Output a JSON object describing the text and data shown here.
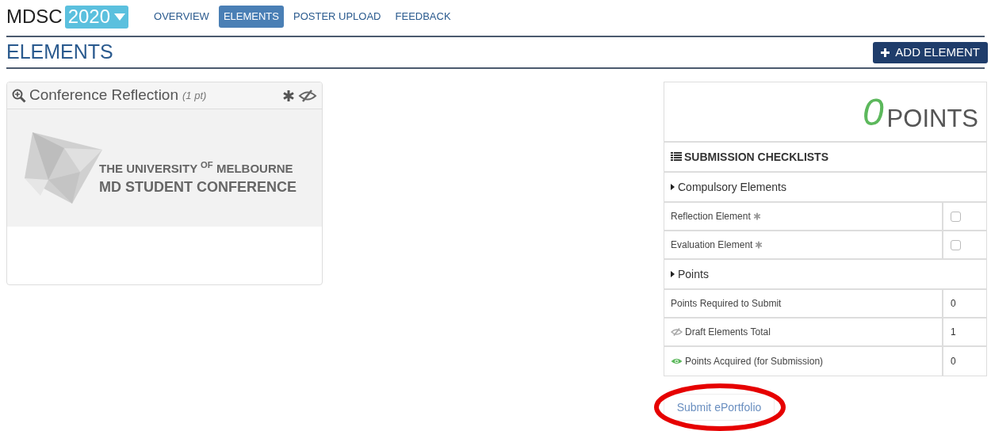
{
  "header": {
    "logo": "MDSC",
    "year": "2020"
  },
  "nav": [
    {
      "label": "OVERVIEW",
      "selected": false
    },
    {
      "label": "ELEMENTS",
      "selected": true
    },
    {
      "label": "POSTER UPLOAD",
      "selected": false
    },
    {
      "label": "FEEDBACK",
      "selected": false
    }
  ],
  "page_title": "ELEMENTS",
  "add_button": "ADD ELEMENT",
  "cards": [
    {
      "title": "Conference Reflection",
      "points": "(1 pt)",
      "banner": [
        "THE UNIVERSITY $^{OF}$ MELBOURNE",
        "MD STUDENT CONFERENCE"
      ]
    }
  ],
  "summary": {
    "points_value": "0",
    "points_label": "POINTS",
    "checklist_title": "SUBMISSION CHECKLISTS",
    "sections": [
      {
        "title": "Compulsory Elements",
        "rows": [
          {
            "kind": "checkbox",
            "label": "Reflection Element",
            "checked": false
          },
          {
            "kind": "checkbox",
            "label": "Evaluation Element",
            "checked": false
          }
        ]
      },
      {
        "title": "Points",
        "rows": [
          {
            "kind": "value",
            "label": "Points Required to Submit",
            "value": "0"
          },
          {
            "kind": "draft",
            "label": "Draft Elements Total",
            "value": "1"
          },
          {
            "kind": "acquired",
            "label": "Points Acquired (for Submission)",
            "value": "0"
          }
        ]
      }
    ]
  },
  "submit_button": "Submit ePortfolio"
}
